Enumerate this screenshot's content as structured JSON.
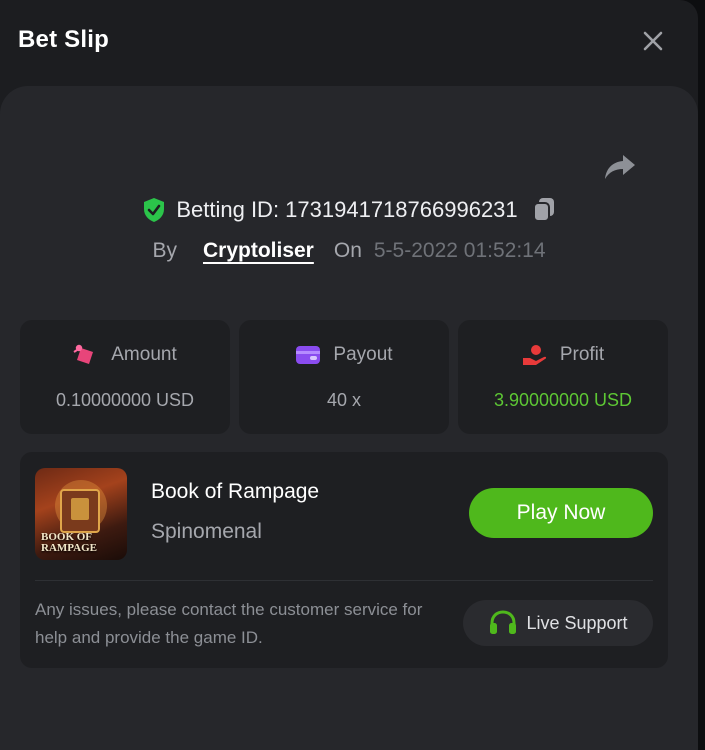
{
  "header": {
    "title": "Bet Slip",
    "close_icon": "close-icon"
  },
  "bet": {
    "betting_id_label": "Betting ID: 1731941718766996231",
    "by_label": "By",
    "user": "Cryptoliser",
    "on_label": "On",
    "date": "5-5-2022 01:52:14"
  },
  "stats": [
    {
      "label": "Amount",
      "value": "0.10000000 USD",
      "icon": "wager-icon",
      "color": "#e8457a"
    },
    {
      "label": "Payout",
      "value": "40 x",
      "icon": "wallet-icon",
      "color": "#8a4cf0"
    },
    {
      "label": "Profit",
      "value": "3.90000000 USD",
      "icon": "profit-hand-icon",
      "color": "#e83a3a"
    }
  ],
  "game": {
    "name": "Book of Rampage",
    "provider": "Spinomenal",
    "thumbnail_text": "BOOK OF RAMPAGE",
    "play_label": "Play Now"
  },
  "support": {
    "text": "Any issues, please contact the customer service for help and provide the game ID.",
    "button_label": "Live Support"
  },
  "colors": {
    "accent_green": "#4fb81c",
    "profit_green": "#5dc734",
    "shield_green": "#2bc44a"
  }
}
